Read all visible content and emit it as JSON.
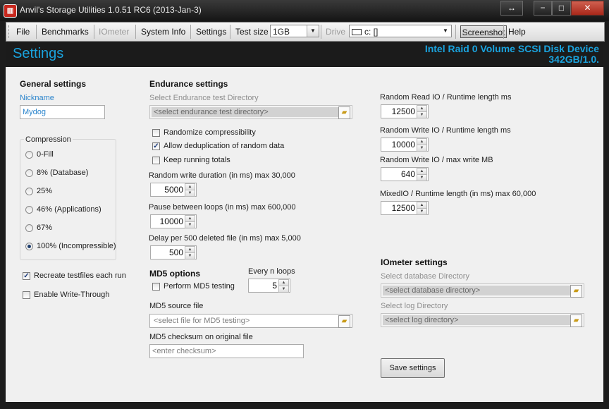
{
  "window": {
    "title": "Anvil's Storage Utilities 1.0.51 RC6 (2013-Jan-3)",
    "icon": "anvil-app-icon",
    "controls": {
      "restore": "↔",
      "minimize": "−",
      "maximize": "□",
      "close": "✕"
    }
  },
  "menu": {
    "file": "File",
    "benchmarks": "Benchmarks",
    "iometer": "IOmeter",
    "system_info": "System Info",
    "settings": "Settings",
    "test_size_label": "Test size",
    "test_size_value": "1GB",
    "drive_label": "Drive",
    "drive_value": "c: []",
    "screenshot": "Screenshot",
    "help": "Help"
  },
  "header": {
    "title": "Settings",
    "device_line1": "Intel Raid 0 Volume SCSI Disk Device",
    "device_line2": "342GB/1.0."
  },
  "general": {
    "heading": "General settings",
    "nickname_label": "Nickname",
    "nickname_value": "Mydog",
    "compression_label": "Compression",
    "compression_options": [
      "0-Fill",
      "8% (Database)",
      "25%",
      "46% (Applications)",
      "67%",
      "100% (Incompressible)"
    ],
    "compression_selected": "100% (Incompressible)",
    "recreate_label": "Recreate testfiles each run",
    "recreate_checked": true,
    "write_through_label": "Enable Write-Through",
    "write_through_checked": false
  },
  "endurance": {
    "heading": "Endurance settings",
    "dir_label": "Select Endurance test Directory",
    "dir_placeholder": "<select endurance test directory>",
    "randomize_label": "Randomize compressibility",
    "randomize_checked": false,
    "dedup_label": "Allow deduplication of random data",
    "dedup_checked": true,
    "keep_totals_label": "Keep running totals",
    "keep_totals_checked": false,
    "rw_duration_label": "Random write duration (in ms) max 30,000",
    "rw_duration_value": "5000",
    "pause_label": "Pause between loops (in ms) max 600,000",
    "pause_value": "10000",
    "delay_label": "Delay per 500 deleted file (in ms) max 5,000",
    "delay_value": "500"
  },
  "md5": {
    "heading": "MD5 options",
    "every_n_label": "Every n loops",
    "every_n_value": "5",
    "perform_label": "Perform MD5 testing",
    "perform_checked": false,
    "source_label": "MD5 source file",
    "source_placeholder": "<select file for MD5 testing>",
    "checksum_label": "MD5 checksum on original file",
    "checksum_placeholder": "<enter checksum>"
  },
  "random_io": {
    "read_label": "Random Read IO / Runtime length ms",
    "read_value": "12500",
    "write_label": "Random Write IO / Runtime length ms",
    "write_value": "10000",
    "write_max_label": "Random Write IO / max write MB",
    "write_max_value": "640",
    "mixed_label": "MixedIO / Runtime length (in ms) max 60,000",
    "mixed_value": "12500"
  },
  "iometer": {
    "heading": "IOmeter settings",
    "db_label": "Select database Directory",
    "db_placeholder": "<select database directory>",
    "log_label": "Select log Directory",
    "log_placeholder": "<select log directory>"
  },
  "save_button": "Save settings",
  "colors": {
    "accent": "#1aa3de",
    "label_blue": "#2a84cc"
  }
}
